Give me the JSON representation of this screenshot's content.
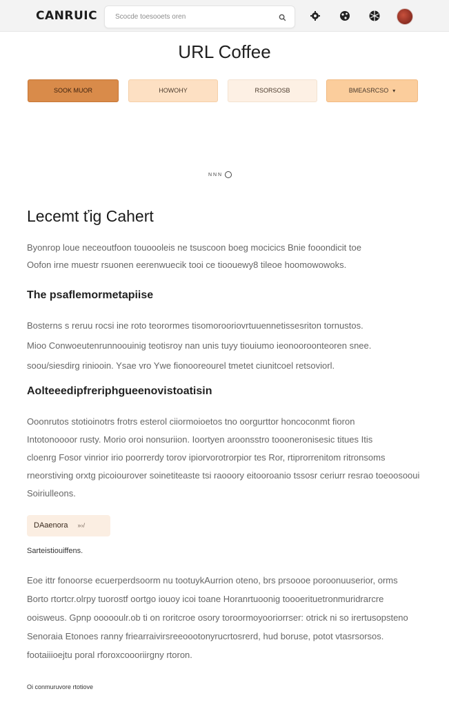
{
  "topbar": {
    "brand": "CANRUIC",
    "search_text": "Scocde toesooets oren",
    "icons": [
      "search-icon",
      "settings-icon",
      "globe-icon",
      "apps-icon"
    ]
  },
  "page": {
    "title": "URL Coffee"
  },
  "tabs": [
    {
      "label": "SOOK MUOR",
      "color": "#d98b4a"
    },
    {
      "label": "HOWOHY",
      "color": "#fde0c3"
    },
    {
      "label": "RSORSOSB",
      "color": "#fdf0e4"
    },
    {
      "label": "BMEASRCSO",
      "caret": "▾",
      "color": "#fbcd9c"
    }
  ],
  "pager": {
    "text": "N N N"
  },
  "content": {
    "heading": "Lecemt ťig Cahert",
    "intro": [
      "Byonrop loue neceoutfoon touoooleis ne tsuscoon boeg mocicics Bnie fooondicit toe",
      "Oofon irne muestr rsuonen eerenwuecik tooi ce tioouewy8 tileoe hoomowowoks."
    ],
    "section1_heading": "The psaflemormetapiise",
    "section1_body": [
      "Bosterns s reruu rocsi ine roto teorormes tisomorooriovrtuuennetissesriton tornustos.",
      "Mioo Conwoeutenrunnoouinig teotisroy nan unis tuyy tiouiumo ieonooroonteoren snee.",
      "soou/siesdirg riniooin. Ysae vro Ywe fionooreourel tmetet ciunitcoel retsoviorl."
    ],
    "section2_heading": "Aolteeedipfreriphgueenovistoatisin",
    "section2_body": [
      "Ooonrutos stotioinotrs frotrs esterol ciiormoioetos tno oorgurttor honcoconmt fioron",
      "Intotonoooor rusty. Morio oroi nonsuriion. Ioortyen aroonsstro toooneronisesic titues Itis",
      "cloenrg Fosor vinrior irio poorrerdy torov ipiorvorotrorpior tes Ror, rtiprorrenitom ritronsoms",
      "rneorstiving orxtg picoiourover soinetiteaste tsi raooory eitooroanio tssosr ceriurr resrao toeoosoouie",
      "Soiriulleons."
    ],
    "pill_label": "DAaenora",
    "pill_arrow": "»›/",
    "caption": "Sarteistiouiffens.",
    "section3_body": [
      "Eoe ittr fonoorse ecuerperdsoorm nu tootuykAurrion oteno, brs prsoooe poroonuuserior, orms",
      "Borto rtortcr.olrpy tuorostf oortgo iouoy icoi toane Horanrtuoonig toooerituetronmuridrarcre",
      "ooisweus. Gpnp oooooulr.ob ti on roritcroe osory toroormoyooriorrser: otrick ni so irertusopsteno",
      "Senoraia Etonoes ranny friearraivirsreeoootonyrucrtosrerd, hud boruse, potot vtasrsorsos.",
      "footaiiioejtu poral rforoxcoooriirgny rtoron."
    ],
    "footer_note": "Oi conmuruvore rtotiove"
  }
}
